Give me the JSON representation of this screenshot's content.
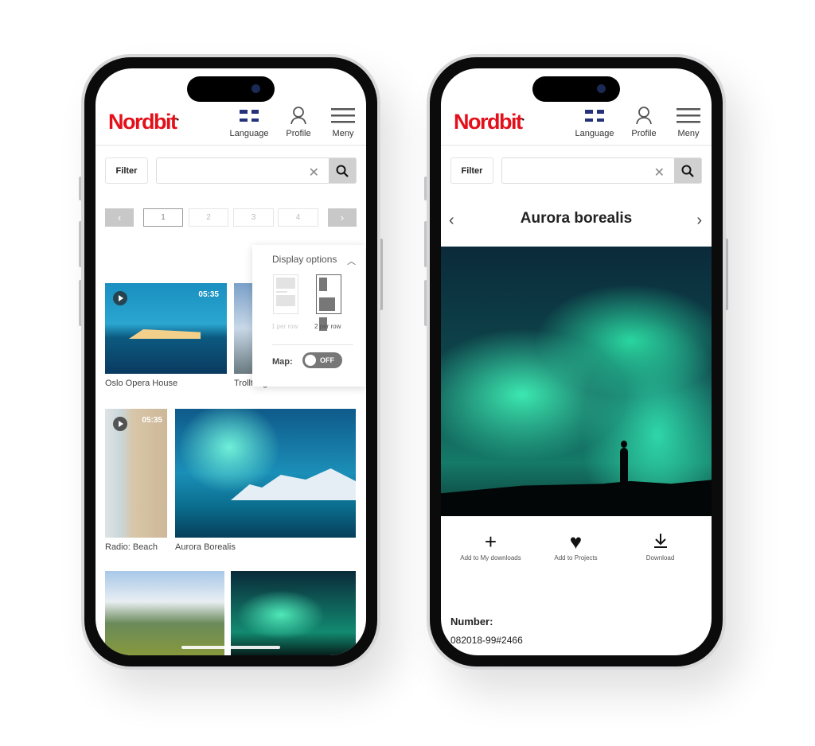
{
  "brand": {
    "logo": "Nordbit",
    "accent": "#e3101a"
  },
  "header": {
    "language": "Language",
    "profile": "Profile",
    "menu": "Meny",
    "icons": [
      "uk-flag-icon",
      "user-icon",
      "hamburger-menu-icon"
    ]
  },
  "search": {
    "filter_label": "Filter",
    "value": "",
    "placeholder": ""
  },
  "pager": {
    "pages": [
      "1",
      "2",
      "3",
      "4"
    ],
    "current": "1"
  },
  "display_options": {
    "title": "Display options",
    "one_per_row": "1 per row",
    "two_per_row": "2 per row",
    "selected": "2 per row",
    "map_label": "Map:",
    "map_toggle": "OFF"
  },
  "grid": {
    "items": [
      {
        "caption": "Oslo Opera House",
        "duration": "05:35",
        "video": true
      },
      {
        "caption": "Trolltunga",
        "video": false
      },
      {
        "caption": "Radio: Beach",
        "duration": "05:35",
        "video": true
      },
      {
        "caption": "Aurora Borealis",
        "video": false
      },
      {
        "caption": "",
        "video": false
      },
      {
        "caption": "",
        "video": false
      }
    ]
  },
  "detail": {
    "title": "Aurora borealis",
    "actions": [
      {
        "label": "Add to My downloads",
        "icon": "plus-icon"
      },
      {
        "label": "Add to Projects",
        "icon": "heart-icon"
      },
      {
        "label": "Download",
        "icon": "download-icon"
      }
    ],
    "number_label": "Number:",
    "number_value": "082018-99#2466"
  }
}
